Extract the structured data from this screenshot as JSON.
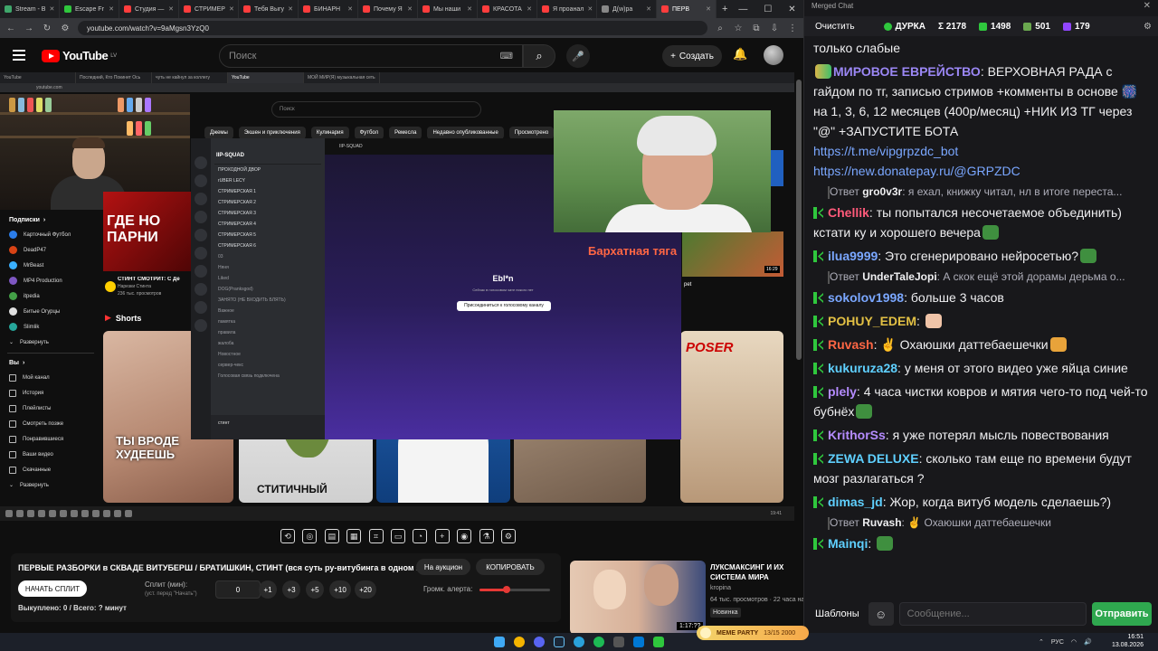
{
  "browser": {
    "tabs": [
      {
        "label": "Stream - B",
        "color": "#3fa76b"
      },
      {
        "label": "Escape Fr",
        "color": "#2fc73d"
      },
      {
        "label": "Студия —",
        "color": "#ff3d3d"
      },
      {
        "label": "СТРИМЕР",
        "color": "#ff3d3d"
      },
      {
        "label": "Тебя Выгу",
        "color": "#ff3d3d"
      },
      {
        "label": "БИНАРН",
        "color": "#ff3d3d"
      },
      {
        "label": "Почему Я",
        "color": "#ff3d3d"
      },
      {
        "label": "Мы наши",
        "color": "#ff3d3d"
      },
      {
        "label": "КРАСОТА",
        "color": "#ff3d3d"
      },
      {
        "label": "Я проанал",
        "color": "#ff3d3d"
      },
      {
        "label": "Д(w)ра",
        "color": "#888888"
      },
      {
        "label": "ПЕРВ",
        "color": "#ff3d3d"
      }
    ],
    "active_tab": 11,
    "url": "youtube.com/watch?v=9aMgsn3YzQ0"
  },
  "youtube": {
    "logo": "YouTube",
    "logo_region": "LV",
    "search_placeholder": "Поиск",
    "create_label": "Создать"
  },
  "video": {
    "inner_tabs": [
      "YouTube",
      "Последний, Кто Покинет Ось",
      "чуть не кайнул за коллегу",
      "YouTube",
      "МОЙ МИР(Я) музыкальная сеть"
    ],
    "inner_url": "youtube.com",
    "inner_search": "Поиск",
    "chips": [
      "Джемы",
      "Экшен и приключения",
      "Кулинария",
      "Футбол",
      "Ремесла",
      "Недавно опубликованные",
      "Просмотрено"
    ],
    "sidebar": {
      "subs_header": "Подписки",
      "subs": [
        {
          "label": "Карточный Футбол",
          "color": "#2b7de9"
        },
        {
          "label": "DeadP47",
          "color": "#d84315"
        },
        {
          "label": "MrBeast",
          "color": "#3ab0ff"
        },
        {
          "label": "MP4 Production",
          "color": "#7e57c2"
        },
        {
          "label": "itpedia",
          "color": "#43a047"
        },
        {
          "label": "Битые Огурцы",
          "color": "#e0e0e0"
        },
        {
          "label": "Slimlik",
          "color": "#26a69a"
        }
      ],
      "expand": "Развернуть",
      "you_header": "Вы",
      "you_items": [
        "Мой канал",
        "История",
        "Плейлисты",
        "Смотреть позже",
        "Понравившиеся",
        "Ваши видео",
        "Скачанные"
      ],
      "expand2": "Развернуть"
    },
    "gde_thumb_text": "ГДЕ НО ПАРНИ",
    "gde_title": "СТИНТ СМОТРИТ: С Де",
    "gde_channel": "Нарезки Стинта",
    "gde_meta": "236 тыс. просмотров",
    "shorts_label": "Shorts",
    "short1_text": "ТЫ ВРОДЕ ХУДЕЕШЬ",
    "short2_text": "СТИТИЧНЫЙ",
    "short5_text": "POSER",
    "pet_text": "pet",
    "discord": {
      "server": "IIP-SQUAD",
      "channels": [
        "ПРОХОДНОЙ ДВОР",
        "rUBER LECY",
        "СТРИМЕРСКАЯ 1",
        "СТРИМЕРСКАЯ 2",
        "СТРИМЕРСКАЯ 3",
        "СТРИМЕРСКАЯ 4",
        "СТРИМЕРСКАЯ 5",
        "СТРИМЕРСКАЯ 6",
        "03",
        "Няня",
        "Liked",
        "DOG(Pranksgod)",
        "ЗАНЯТО (НЕ ВХОДИТЬ БЛЯТЬ)",
        "Важное",
        "памятка",
        "правила",
        "жалоба",
        "Новостное",
        "сервер-чекс",
        "Голосовая связь подключена"
      ],
      "user": "стинт",
      "header": "IIP-SQUAD",
      "title": "Ebl*n",
      "subtitle": "Сейчас в голосовом чате никого нет",
      "join_button": "Присоединиться к голосовому каналу"
    },
    "overlay_text": "Бархатная тяга",
    "food_duration": "16:29",
    "inner_clock": "19:41"
  },
  "player_controls": [
    "repeat-icon",
    "broadcast-icon",
    "subtitles-icon",
    "clapper-icon",
    "crop-icon",
    "pip-icon",
    "speed-icon",
    "add-clip-icon",
    "screenshot-icon",
    "flask-icon",
    "settings-icon"
  ],
  "info": {
    "title": "ПЕРВЫЕ РАЗБОРКИ в СКВАДЕ ВИТУБЕРШ / БРАТИШКИН, СТИНТ (вся суть ру-витубинга в одном видео)",
    "auction_label": "На аукцион",
    "copy_label": "КОПИРОВАТЬ",
    "start_label": "НАЧАТЬ СПЛИТ",
    "split_label": "Сплит (мин):",
    "split_hint": "(уст. перед \"Начать\")",
    "split_value": "0",
    "increments": [
      "+1",
      "+3",
      "+5",
      "+10",
      "+20"
    ],
    "alert_label": "Громк. алерта:",
    "alert_level": 0.38,
    "bought": "Выкуплено: 0 / Всего: ? минут"
  },
  "recommendation": {
    "title": "ЛУКСМАКСИНГ И ИХ СИСТЕМА МИРА",
    "channel": "kropina",
    "meta": "64 тыс. просмотров · 22 часа назад",
    "badge": "Новинка",
    "duration": "1:17:??"
  },
  "chat": {
    "window_title": "Merged Chat",
    "clear_label": "Очистить",
    "stats": [
      {
        "icon": "dot",
        "value": "ДУРКА",
        "color": "#2fc73d"
      },
      {
        "icon": "sigma",
        "value": "Σ 2178",
        "color": "#ffffff"
      },
      {
        "icon": "kick",
        "value": "1498",
        "color": "#2fc73d"
      },
      {
        "icon": "pepe",
        "value": "501",
        "color": "#6aa84f"
      },
      {
        "icon": "twitch",
        "value": "179",
        "color": "#9146ff"
      }
    ],
    "messages": [
      {
        "type": "msg",
        "user": "",
        "color": "#efeff1",
        "text": "только слабые",
        "badge": false
      },
      {
        "type": "msg",
        "user": "МИРОВОЕ ЕВРЕЙСТВО",
        "color": "#9b87f5",
        "text": "ВЕРХОВНАЯ РАДА с гайдом по тг, записью стримов +комменты в основе 🎆 на 1, 3, 6, 12 месяцев (400р/месяц) +НИК ИЗ ТГ через \"@\" +ЗАПУСТИТЕ БОТА",
        "links": [
          "https://t.me/vipgrpzdc_bot",
          "https://new.donatepay.ru/@GRPZDC"
        ],
        "badge": false
      },
      {
        "type": "reply",
        "user": "gro0v3r",
        "text": "я ехал, книжку читал, нл в итоге переста..."
      },
      {
        "type": "msg",
        "user": "Chellik",
        "color": "#ff5a7a",
        "text": "ты попытался несочетаемое объединить) кстати ку и хорошего вечера",
        "badge": true
      },
      {
        "type": "msg",
        "user": "ilua9999",
        "color": "#7aa7ff",
        "text": "Это сгенерировано нейросетью?",
        "badge": true
      },
      {
        "type": "reply",
        "user": "UnderTaleJopi",
        "text": "А скок ещё этой дорамы дерьма о..."
      },
      {
        "type": "msg",
        "user": "sokolov1998",
        "color": "#7aa7ff",
        "text": "больше 3 часов",
        "badge": true
      },
      {
        "type": "msg",
        "user": "POHUY_EDEM",
        "color": "#e2c044",
        "text": "",
        "badge": true
      },
      {
        "type": "msg",
        "user": "Ruvash",
        "color": "#ff6644",
        "text": "✌ Охаюшки даттебаешечки",
        "badge": true
      },
      {
        "type": "msg",
        "user": "kukuruza28",
        "color": "#5fd0ff",
        "text": "у меня от этого видео уже яйца синие",
        "badge": true
      },
      {
        "type": "msg",
        "user": "plely",
        "color": "#b58cff",
        "text": "4 часа чистки ковров и мятия чего-то под чей-то бубнёх",
        "badge": true
      },
      {
        "type": "msg",
        "user": "KrithorSs",
        "color": "#b58cff",
        "text": "я уже потерял мысль повествования",
        "badge": true
      },
      {
        "type": "msg",
        "user": "ZEWA DELUXE",
        "color": "#5fd0ff",
        "text": "сколько там еще по времени будут мозг разлагаться ?",
        "badge": true
      },
      {
        "type": "msg",
        "user": "dimas_jd",
        "color": "#5fd0ff",
        "text": "Жор, когда витуб модель сделаешь?)",
        "badge": true
      },
      {
        "type": "reply",
        "user": "Ruvash",
        "text": "✌ Охаюшки даттебаешечки"
      },
      {
        "type": "msg",
        "user": "Mainqi",
        "color": "#5fd0ff",
        "text": "",
        "badge": true
      }
    ],
    "templates_label": "Шаблоны",
    "input_placeholder": "Сообщение...",
    "send_label": "Отправить"
  },
  "taskbar": {
    "meme_text": "MEME PARTY",
    "meme_sub": "13/15 2000",
    "lang": "РУС",
    "time": "16:51",
    "date": "13.08.2026"
  }
}
